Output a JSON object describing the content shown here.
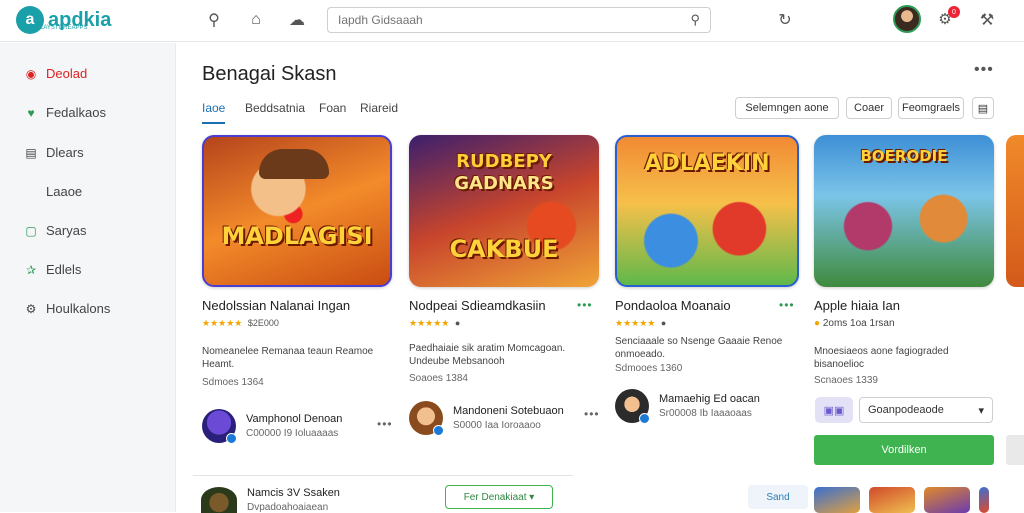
{
  "app": {
    "logo_letter": "a",
    "name": "apdkia",
    "tagline": "PLAYSTOREAPPS"
  },
  "topbar": {
    "search_placeholder": "Iapdh Gidsaaah",
    "notification_count": "0",
    "icons": [
      "search-icon",
      "home-icon",
      "cloud-icon",
      "refresh-icon",
      "bell-icon",
      "tools-icon"
    ]
  },
  "sidebar": {
    "items": [
      {
        "label": "Deolad",
        "icon": "home-icon",
        "active": true
      },
      {
        "label": "Fedalkaos",
        "icon": "heart-icon"
      },
      {
        "label": "Dlears",
        "icon": "list-icon"
      },
      {
        "label": "Laaoe"
      },
      {
        "label": "Saryas",
        "icon": "tag-icon"
      },
      {
        "label": "Edlels",
        "icon": "book-icon"
      },
      {
        "label": "Houlkalons",
        "icon": "gear-icon"
      }
    ]
  },
  "main": {
    "title": "Benagai Skasn",
    "tabs": [
      "Iaoe",
      "Beddsatnia",
      "Foan",
      "Riareid"
    ],
    "filters": {
      "sort": "Selemngen aone",
      "view": "Coaer",
      "more": "Feomgraels"
    }
  },
  "cards": [
    {
      "art_title": "MADLAGISI",
      "name": "Nedolssian Nalanai Ingan",
      "rating": "$2E000",
      "desc": "Nomeanelee Remanaa teaun Reamoe Heamt.",
      "meta": "Sdmoes 1364",
      "dev_name": "Vamphonol Denoan",
      "dev_sub": "C00000 I9 Ioluaaaas"
    },
    {
      "art_title_1": "RUDBEPY",
      "art_title_2": "GADNARS",
      "art_title_3": "CAKBUE",
      "name": "Nodpeai Sdieamdkasiin",
      "desc": "Paedhaiaie sik aratim Momcagoan. Undeube Mebsanooh",
      "meta": "Soaoes 1384",
      "dev_name": "Mandoneni Sotebuaon",
      "dev_sub": "S0000 Iaa Ioroaaoo"
    },
    {
      "art_title_1": "ADLAEKIN",
      "name": "Pondaoloa Moanaio",
      "desc": "Senciaaale so Nsenge Gaaaie Renoe onmoeado.",
      "meta": "Sdmooes 1360",
      "dev_name": "Mamaehig Ed oacan",
      "dev_sub": "Sr00008 Ib Iaaaoaas"
    },
    {
      "art_title_1": "BOERODIE",
      "name": "Apple hiaia Ian",
      "rating": "2oms 1oa 1rsan",
      "desc": "Mnoesiaeos aone fagiograded bisanoelioc",
      "meta": "Scnaoes 1339",
      "dropdown": "Goanpodeaode",
      "action": "Vordilken"
    }
  ],
  "bottom": {
    "title": "Namcis 3V Ssaken",
    "sub": "Dvpadoahoaiaean",
    "button": "Fer Denakiaat",
    "ghost": "Sand"
  }
}
